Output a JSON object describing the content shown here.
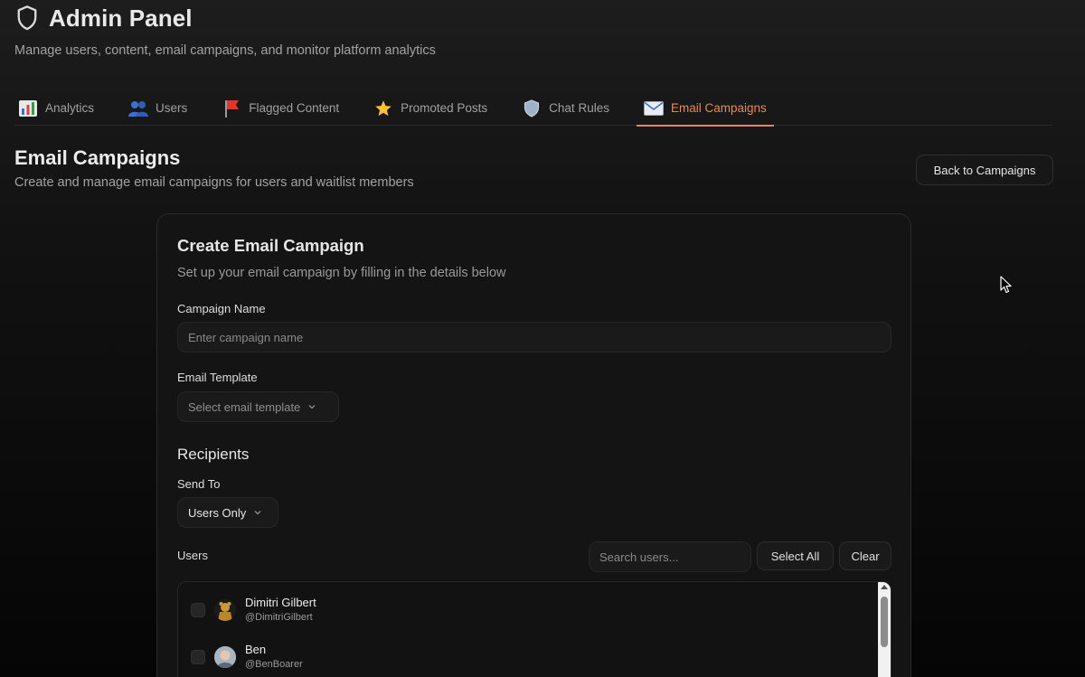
{
  "header": {
    "title": "Admin Panel",
    "subtitle": "Manage users, content, email campaigns, and monitor platform analytics",
    "icon": "shield-icon"
  },
  "tabs": [
    {
      "label": "Analytics",
      "icon": "chart-icon",
      "emoji": "📊",
      "active": false
    },
    {
      "label": "Users",
      "icon": "users-icon",
      "emoji": "👥",
      "active": false
    },
    {
      "label": "Flagged Content",
      "icon": "flag-icon",
      "emoji": "🚩",
      "active": false
    },
    {
      "label": "Promoted Posts",
      "icon": "star-icon",
      "emoji": "⭐",
      "active": false
    },
    {
      "label": "Chat Rules",
      "icon": "shield-icon",
      "emoji": "🛡️",
      "active": false
    },
    {
      "label": "Email Campaigns",
      "icon": "email-icon",
      "emoji": "📧",
      "active": true
    }
  ],
  "section": {
    "title": "Email Campaigns",
    "subtitle": "Create and manage email campaigns for users and waitlist members",
    "back_button": "Back to Campaigns"
  },
  "form": {
    "title": "Create Email Campaign",
    "subtitle": "Set up your email campaign by filling in the details below",
    "campaign_name_label": "Campaign Name",
    "campaign_name_placeholder": "Enter campaign name",
    "campaign_name_value": "",
    "template_label": "Email Template",
    "template_placeholder": "Select email template",
    "recipients_title": "Recipients",
    "send_to_label": "Send To",
    "send_to_value": "Users Only",
    "users_label": "Users",
    "search_placeholder": "Search users...",
    "select_all_label": "Select All",
    "clear_label": "Clear"
  },
  "users": [
    {
      "name": "Dimitri Gilbert",
      "handle": "@DimitriGilbert",
      "checked": false
    },
    {
      "name": "Ben",
      "handle": "@BenBoarer",
      "checked": false
    }
  ],
  "colors": {
    "accent": "#e8875a",
    "background": "#121212",
    "card": "#141414",
    "text_muted": "#a3a3a3"
  }
}
